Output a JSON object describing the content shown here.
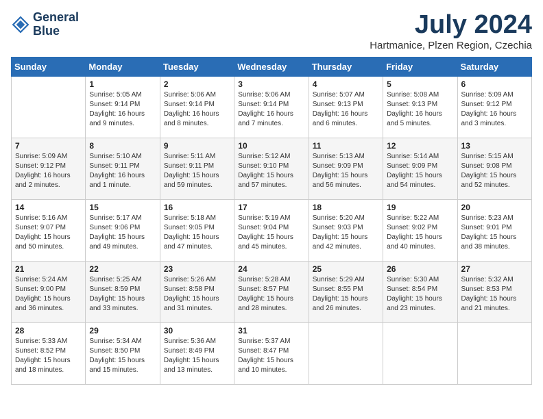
{
  "header": {
    "logo_line1": "General",
    "logo_line2": "Blue",
    "month_title": "July 2024",
    "location": "Hartmanice, Plzen Region, Czechia"
  },
  "weekdays": [
    "Sunday",
    "Monday",
    "Tuesday",
    "Wednesday",
    "Thursday",
    "Friday",
    "Saturday"
  ],
  "weeks": [
    [
      {
        "day": "",
        "sunrise": "",
        "sunset": "",
        "daylight": ""
      },
      {
        "day": "1",
        "sunrise": "Sunrise: 5:05 AM",
        "sunset": "Sunset: 9:14 PM",
        "daylight": "Daylight: 16 hours and 9 minutes."
      },
      {
        "day": "2",
        "sunrise": "Sunrise: 5:06 AM",
        "sunset": "Sunset: 9:14 PM",
        "daylight": "Daylight: 16 hours and 8 minutes."
      },
      {
        "day": "3",
        "sunrise": "Sunrise: 5:06 AM",
        "sunset": "Sunset: 9:14 PM",
        "daylight": "Daylight: 16 hours and 7 minutes."
      },
      {
        "day": "4",
        "sunrise": "Sunrise: 5:07 AM",
        "sunset": "Sunset: 9:13 PM",
        "daylight": "Daylight: 16 hours and 6 minutes."
      },
      {
        "day": "5",
        "sunrise": "Sunrise: 5:08 AM",
        "sunset": "Sunset: 9:13 PM",
        "daylight": "Daylight: 16 hours and 5 minutes."
      },
      {
        "day": "6",
        "sunrise": "Sunrise: 5:09 AM",
        "sunset": "Sunset: 9:12 PM",
        "daylight": "Daylight: 16 hours and 3 minutes."
      }
    ],
    [
      {
        "day": "7",
        "sunrise": "Sunrise: 5:09 AM",
        "sunset": "Sunset: 9:12 PM",
        "daylight": "Daylight: 16 hours and 2 minutes."
      },
      {
        "day": "8",
        "sunrise": "Sunrise: 5:10 AM",
        "sunset": "Sunset: 9:11 PM",
        "daylight": "Daylight: 16 hours and 1 minute."
      },
      {
        "day": "9",
        "sunrise": "Sunrise: 5:11 AM",
        "sunset": "Sunset: 9:11 PM",
        "daylight": "Daylight: 15 hours and 59 minutes."
      },
      {
        "day": "10",
        "sunrise": "Sunrise: 5:12 AM",
        "sunset": "Sunset: 9:10 PM",
        "daylight": "Daylight: 15 hours and 57 minutes."
      },
      {
        "day": "11",
        "sunrise": "Sunrise: 5:13 AM",
        "sunset": "Sunset: 9:09 PM",
        "daylight": "Daylight: 15 hours and 56 minutes."
      },
      {
        "day": "12",
        "sunrise": "Sunrise: 5:14 AM",
        "sunset": "Sunset: 9:09 PM",
        "daylight": "Daylight: 15 hours and 54 minutes."
      },
      {
        "day": "13",
        "sunrise": "Sunrise: 5:15 AM",
        "sunset": "Sunset: 9:08 PM",
        "daylight": "Daylight: 15 hours and 52 minutes."
      }
    ],
    [
      {
        "day": "14",
        "sunrise": "Sunrise: 5:16 AM",
        "sunset": "Sunset: 9:07 PM",
        "daylight": "Daylight: 15 hours and 50 minutes."
      },
      {
        "day": "15",
        "sunrise": "Sunrise: 5:17 AM",
        "sunset": "Sunset: 9:06 PM",
        "daylight": "Daylight: 15 hours and 49 minutes."
      },
      {
        "day": "16",
        "sunrise": "Sunrise: 5:18 AM",
        "sunset": "Sunset: 9:05 PM",
        "daylight": "Daylight: 15 hours and 47 minutes."
      },
      {
        "day": "17",
        "sunrise": "Sunrise: 5:19 AM",
        "sunset": "Sunset: 9:04 PM",
        "daylight": "Daylight: 15 hours and 45 minutes."
      },
      {
        "day": "18",
        "sunrise": "Sunrise: 5:20 AM",
        "sunset": "Sunset: 9:03 PM",
        "daylight": "Daylight: 15 hours and 42 minutes."
      },
      {
        "day": "19",
        "sunrise": "Sunrise: 5:22 AM",
        "sunset": "Sunset: 9:02 PM",
        "daylight": "Daylight: 15 hours and 40 minutes."
      },
      {
        "day": "20",
        "sunrise": "Sunrise: 5:23 AM",
        "sunset": "Sunset: 9:01 PM",
        "daylight": "Daylight: 15 hours and 38 minutes."
      }
    ],
    [
      {
        "day": "21",
        "sunrise": "Sunrise: 5:24 AM",
        "sunset": "Sunset: 9:00 PM",
        "daylight": "Daylight: 15 hours and 36 minutes."
      },
      {
        "day": "22",
        "sunrise": "Sunrise: 5:25 AM",
        "sunset": "Sunset: 8:59 PM",
        "daylight": "Daylight: 15 hours and 33 minutes."
      },
      {
        "day": "23",
        "sunrise": "Sunrise: 5:26 AM",
        "sunset": "Sunset: 8:58 PM",
        "daylight": "Daylight: 15 hours and 31 minutes."
      },
      {
        "day": "24",
        "sunrise": "Sunrise: 5:28 AM",
        "sunset": "Sunset: 8:57 PM",
        "daylight": "Daylight: 15 hours and 28 minutes."
      },
      {
        "day": "25",
        "sunrise": "Sunrise: 5:29 AM",
        "sunset": "Sunset: 8:55 PM",
        "daylight": "Daylight: 15 hours and 26 minutes."
      },
      {
        "day": "26",
        "sunrise": "Sunrise: 5:30 AM",
        "sunset": "Sunset: 8:54 PM",
        "daylight": "Daylight: 15 hours and 23 minutes."
      },
      {
        "day": "27",
        "sunrise": "Sunrise: 5:32 AM",
        "sunset": "Sunset: 8:53 PM",
        "daylight": "Daylight: 15 hours and 21 minutes."
      }
    ],
    [
      {
        "day": "28",
        "sunrise": "Sunrise: 5:33 AM",
        "sunset": "Sunset: 8:52 PM",
        "daylight": "Daylight: 15 hours and 18 minutes."
      },
      {
        "day": "29",
        "sunrise": "Sunrise: 5:34 AM",
        "sunset": "Sunset: 8:50 PM",
        "daylight": "Daylight: 15 hours and 15 minutes."
      },
      {
        "day": "30",
        "sunrise": "Sunrise: 5:36 AM",
        "sunset": "Sunset: 8:49 PM",
        "daylight": "Daylight: 15 hours and 13 minutes."
      },
      {
        "day": "31",
        "sunrise": "Sunrise: 5:37 AM",
        "sunset": "Sunset: 8:47 PM",
        "daylight": "Daylight: 15 hours and 10 minutes."
      },
      {
        "day": "",
        "sunrise": "",
        "sunset": "",
        "daylight": ""
      },
      {
        "day": "",
        "sunrise": "",
        "sunset": "",
        "daylight": ""
      },
      {
        "day": "",
        "sunrise": "",
        "sunset": "",
        "daylight": ""
      }
    ]
  ]
}
